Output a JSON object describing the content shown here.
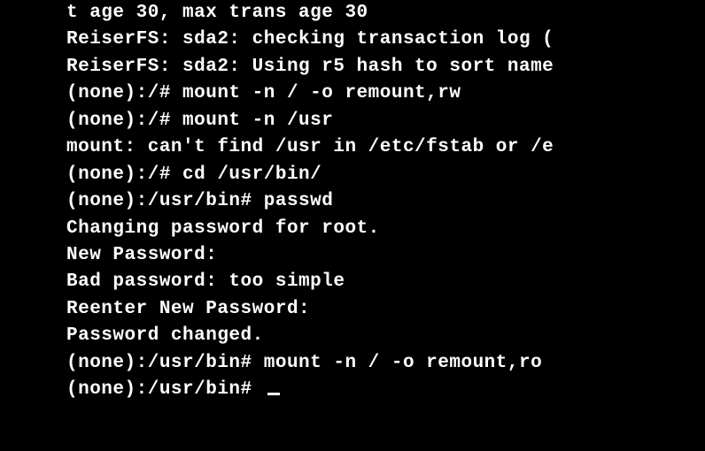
{
  "terminal": {
    "lines": [
      "t age 30, max trans age 30",
      "ReiserFS: sda2: checking transaction log (",
      "ReiserFS: sda2: Using r5 hash to sort name",
      "(none):/# mount -n / -o remount,rw",
      "(none):/# mount -n /usr",
      "mount: can't find /usr in /etc/fstab or /e",
      "(none):/# cd /usr/bin/",
      "(none):/usr/bin# passwd",
      "Changing password for root.",
      "New Password:",
      "Bad password: too simple",
      "Reenter New Password:",
      "Password changed.",
      "(none):/usr/bin# mount -n / -o remount,ro",
      "(none):/usr/bin# "
    ]
  }
}
